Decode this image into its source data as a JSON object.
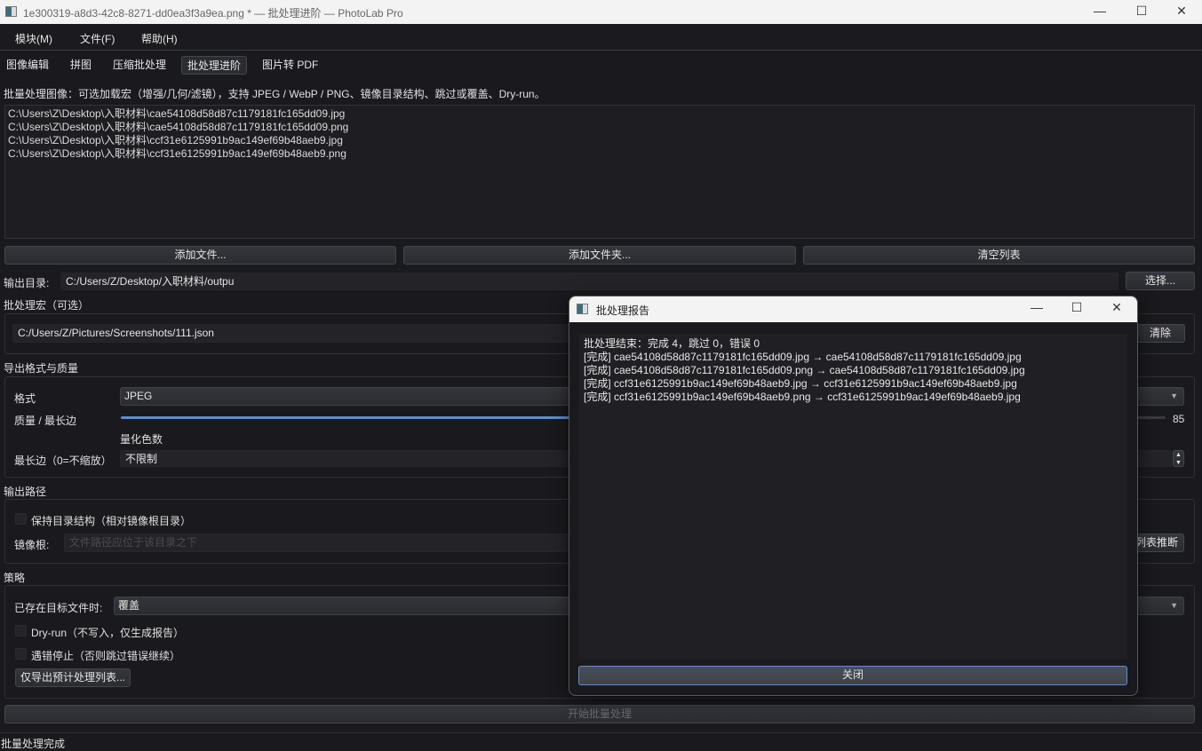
{
  "window": {
    "title": "1e300319-a8d3-42c8-8271-dd0ea3f3a9ea.png * — 批处理进阶 — PhotoLab Pro",
    "minimize": "—",
    "maximize": "☐",
    "close": "✕"
  },
  "menu": [
    "模块(M)",
    "文件(F)",
    "帮助(H)"
  ],
  "tabs": [
    {
      "label": "图像编辑"
    },
    {
      "label": "拼图"
    },
    {
      "label": "压缩批处理"
    },
    {
      "label": "批处理进阶",
      "active": true
    },
    {
      "label": "图片转 PDF"
    }
  ],
  "description": "批量处理图像：可选加载宏（增强/几何/滤镜），支持 JPEG / WebP / PNG、镜像目录结构、跳过或覆盖、Dry-run。",
  "file_list": [
    "C:\\Users\\Z\\Desktop\\入职材料\\cae54108d58d87c1179181fc165dd09.jpg",
    "C:\\Users\\Z\\Desktop\\入职材料\\cae54108d58d87c1179181fc165dd09.png",
    "C:\\Users\\Z\\Desktop\\入职材料\\ccf31e6125991b9ac149ef69b48aeb9.jpg",
    "C:\\Users\\Z\\Desktop\\入职材料\\ccf31e6125991b9ac149ef69b48aeb9.png"
  ],
  "buttons": {
    "add_files": "添加文件...",
    "add_folder": "添加文件夹...",
    "clear_list": "清空列表",
    "choose": "选择...",
    "clear_macro": "清除",
    "infer_root": "列表推断",
    "export_plan": "仅导出预计处理列表...",
    "start": "开始批量处理"
  },
  "output_dir": {
    "label": "输出目录:",
    "value": "C:/Users/Z/Desktop/入职材料/outpu"
  },
  "macro": {
    "title": "批处理宏（可选）",
    "value": "C:/Users/Z/Pictures/Screenshots/111.json"
  },
  "format": {
    "title": "导出格式与质量",
    "format_label": "格式",
    "format_value": "JPEG",
    "quality_label": "质量 / 最长边",
    "quality_value": 85,
    "quality_max": 100,
    "quant_label": "量化色数",
    "maxedge_label": "最长边（0=不缩放）",
    "maxedge_value": "不限制"
  },
  "output_path": {
    "title": "输出路径",
    "keep_structure": "保持目录结构（相对镜像根目录）",
    "keep_structure_checked": false,
    "mirror_label": "镜像根:",
    "mirror_placeholder": "文件路径应位于该目录之下"
  },
  "strategy": {
    "title": "策略",
    "exists_label": "已存在目标文件时:",
    "exists_value": "覆盖",
    "dryrun": "Dry-run（不写入，仅生成报告）",
    "dryrun_checked": false,
    "stop_on_error": "遇错停止（否则跳过错误继续）",
    "stop_checked": false
  },
  "status": "批量处理完成",
  "dialog": {
    "title": "批处理报告",
    "lines": [
      "批处理结束：完成 4，跳过 0，错误 0",
      "[完成] cae54108d58d87c1179181fc165dd09.jpg → cae54108d58d87c1179181fc165dd09.jpg",
      "[完成] cae54108d58d87c1179181fc165dd09.png → cae54108d58d87c1179181fc165dd09.jpg",
      "[完成] ccf31e6125991b9ac149ef69b48aeb9.jpg → ccf31e6125991b9ac149ef69b48aeb9.jpg",
      "[完成] ccf31e6125991b9ac149ef69b48aeb9.png → ccf31e6125991b9ac149ef69b48aeb9.jpg"
    ],
    "close_button": "关闭"
  },
  "colors": {
    "accent": "#5b8fd6",
    "background": "#1a1a1e"
  }
}
